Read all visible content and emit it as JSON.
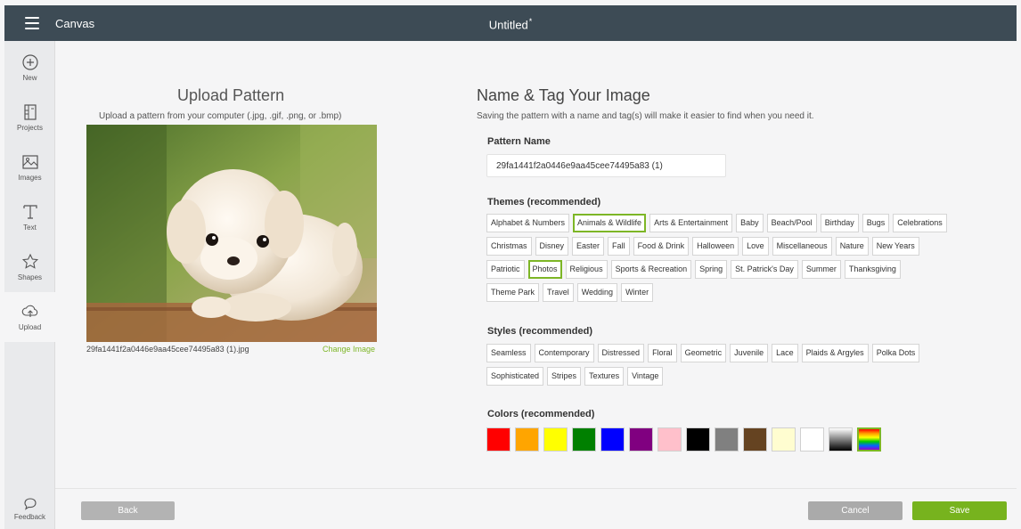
{
  "topbar": {
    "app_title": "Canvas",
    "doc_title": "Untitled",
    "unsaved_marker": "*"
  },
  "sidebar": {
    "items": [
      {
        "label": "New",
        "icon": "plus-circle-icon"
      },
      {
        "label": "Projects",
        "icon": "projects-icon"
      },
      {
        "label": "Images",
        "icon": "image-icon"
      },
      {
        "label": "Text",
        "icon": "text-icon"
      },
      {
        "label": "Shapes",
        "icon": "shapes-icon"
      },
      {
        "label": "Upload",
        "icon": "upload-icon"
      }
    ],
    "feedback_label": "Feedback"
  },
  "upload": {
    "title": "Upload Pattern",
    "subtitle": "Upload a pattern from your computer (.jpg, .gif, .png, or .bmp)",
    "file_name": "29fa1441f2a0446e9aa45cee74495a83 (1).jpg",
    "change_label": "Change Image"
  },
  "tagging": {
    "title": "Name & Tag Your Image",
    "subtitle": "Saving the pattern with a name and tag(s) will make it easier to find when you need it.",
    "pattern_name_label": "Pattern Name",
    "pattern_name_value": "29fa1441f2a0446e9aa45cee74495a83 (1)",
    "themes_label": "Themes (recommended)",
    "themes": [
      [
        "Alphabet & Numbers",
        "Animals & Wildlife",
        "Arts & Entertainment",
        "Baby",
        "Beach/Pool",
        "Birthday",
        "Bugs",
        "Celebrations"
      ],
      [
        "Christmas",
        "Disney",
        "Easter",
        "Fall",
        "Food & Drink",
        "Halloween",
        "Love",
        "Miscellaneous",
        "Nature",
        "New Years"
      ],
      [
        "Patriotic",
        "Photos",
        "Religious",
        "Sports & Recreation",
        "Spring",
        "St. Patrick's Day",
        "Summer",
        "Thanksgiving"
      ],
      [
        "Theme Park",
        "Travel",
        "Wedding",
        "Winter"
      ]
    ],
    "selected_themes": [
      "Animals & Wildlife",
      "Photos"
    ],
    "styles_label": "Styles (recommended)",
    "styles": [
      [
        "Seamless",
        "Contemporary",
        "Distressed",
        "Floral",
        "Geometric",
        "Juvenile",
        "Lace",
        "Plaids & Argyles",
        "Polka Dots"
      ],
      [
        "Sophisticated",
        "Stripes",
        "Textures",
        "Vintage"
      ]
    ],
    "colors_label": "Colors (recommended)",
    "colors": [
      {
        "name": "red",
        "hex": "#ff0000"
      },
      {
        "name": "orange",
        "hex": "#ffa500"
      },
      {
        "name": "yellow",
        "hex": "#ffff00"
      },
      {
        "name": "green",
        "hex": "#008000"
      },
      {
        "name": "blue",
        "hex": "#0000ff"
      },
      {
        "name": "purple",
        "hex": "#800080"
      },
      {
        "name": "pink",
        "hex": "#ffc0cb"
      },
      {
        "name": "black",
        "hex": "#000000"
      },
      {
        "name": "gray",
        "hex": "#808080"
      },
      {
        "name": "brown",
        "hex": "#654321"
      },
      {
        "name": "cream",
        "hex": "#fffdd0"
      },
      {
        "name": "white",
        "hex": "#ffffff"
      },
      {
        "name": "black-white gradient",
        "hex": "gradient-bw"
      },
      {
        "name": "multicolor",
        "hex": "rainbow"
      }
    ],
    "selected_color": "multicolor"
  },
  "footer": {
    "back_label": "Back",
    "cancel_label": "Cancel",
    "save_label": "Save"
  },
  "accent_color": "#7db626"
}
